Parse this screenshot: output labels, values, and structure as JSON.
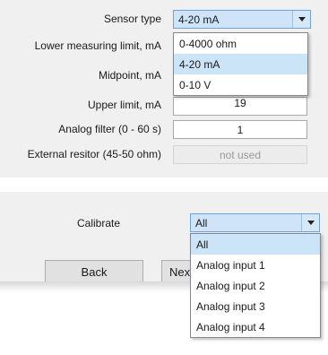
{
  "sensor": {
    "type_label": "Sensor type",
    "type_value": "4-20 mA",
    "options": [
      "0-4000 ohm",
      "4-20 mA",
      "0-10 V"
    ],
    "highlighted_option": "4-20 mA"
  },
  "fields": {
    "lower_label": "Lower measuring limit, mA",
    "midpoint_label": "Midpoint, mA",
    "upper_label": "Upper limit, mA",
    "upper_value": "19",
    "filter_label": "Analog filter (0 - 60 s)",
    "filter_value": "1",
    "resistor_label": "External resitor (45-50 ohm)",
    "resistor_value": "not used"
  },
  "calibrate": {
    "label": "Calibrate",
    "value": "All",
    "options": [
      "All",
      "Analog input 1",
      "Analog input 2",
      "Analog input 3",
      "Analog input 4"
    ],
    "highlighted_option": "All"
  },
  "buttons": {
    "back": "Back",
    "next_partial": "Nex"
  }
}
